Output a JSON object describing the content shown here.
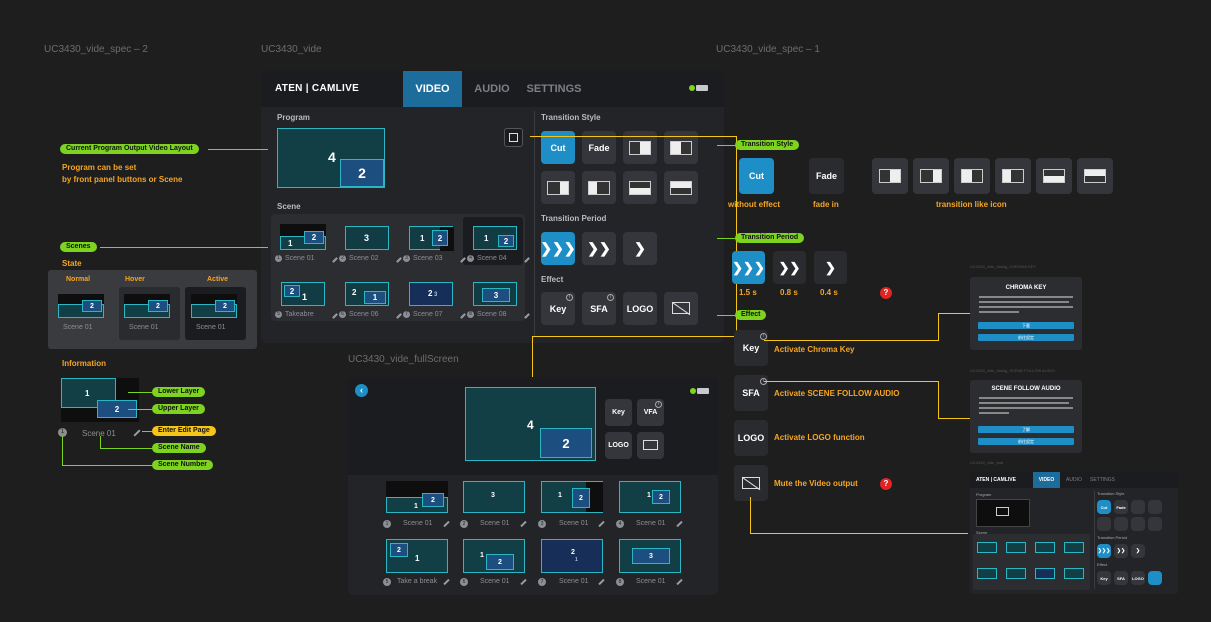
{
  "frames": {
    "spec2": "UC3430_vide_spec – 2",
    "vide": "UC3430_vide",
    "spec1": "UC3430_vide_spec – 1",
    "fullscreen": "UC3430_vide_fullScreen",
    "mini_label": "UC3430_vide_stat"
  },
  "app": {
    "logo": "ATEN | CAMLIVE",
    "tabs": [
      "VIDEO",
      "AUDIO",
      "SETTINGS"
    ],
    "program_label": "Program",
    "program_big": "4",
    "program_small": "2",
    "scene_label": "Scene",
    "transition_style_label": "Transition Style",
    "transition_period_label": "Transition Period",
    "effect_label": "Effect",
    "cut": "Cut",
    "fade": "Fade",
    "effects": [
      "Key",
      "SFA",
      "LOGO"
    ],
    "scenes": [
      {
        "n": "1",
        "name": "Scene 01",
        "big": "1",
        "small": "2"
      },
      {
        "n": "2",
        "name": "Scene 02",
        "big": "3",
        "small": ""
      },
      {
        "n": "3",
        "name": "Scene 03",
        "big": "1",
        "small": "2"
      },
      {
        "n": "4",
        "name": "Scene 04",
        "big": "1",
        "small": "2"
      },
      {
        "n": "5",
        "name": "Takeabre",
        "big": "1",
        "small": "2"
      },
      {
        "n": "6",
        "name": "Scene 06",
        "big": "2",
        "small": "1"
      },
      {
        "n": "7",
        "name": "Scene 07",
        "big": "2",
        "small": "3"
      },
      {
        "n": "8",
        "name": "Scene 08",
        "big": "3",
        "small": ""
      }
    ]
  },
  "spec_left": {
    "program_pill": "Current Program Output Video Layout",
    "program_note_1": "Program can be set",
    "program_note_2": "by front panel buttons or  Scene",
    "scenes_pill": "Scenes",
    "state_label": "State",
    "states": [
      "Normal",
      "Hover",
      "Active"
    ],
    "state_scene_name": "Scene 01",
    "information_label": "Information",
    "lower_layer": "Lower Layer",
    "upper_layer": "Upper Layer",
    "enter_edit": "Enter Edit Page",
    "scene_name": "Scene Name",
    "scene_number": "Scene Number",
    "info_scene": "Scene 01",
    "info_num": "1",
    "info_big": "1",
    "info_small": "2"
  },
  "spec_right": {
    "ts_pill": "Transition Style",
    "cut_caption": "without effect",
    "fade_caption": "fade in",
    "icon_caption": "transition like icon",
    "tp_pill": "Transition Period",
    "periods": [
      "1.5 s",
      "0.8 s",
      "0.4 s"
    ],
    "effect_pill": "Effect",
    "key_text": "Activate Chroma Key",
    "sfa_text": "Activate SCENE FOLLOW AUDIO",
    "logo_text": "Activate LOGO function",
    "mute_text": "Mute the Video output",
    "q": "?"
  },
  "modals": {
    "chroma_title": "CHROMA KEY",
    "chroma_small_label": "UC3430_vide_dialog_CHROMA KEY",
    "chroma_btn1": "下載",
    "chroma_btn2": "前往設定",
    "sfa_title": "SCENE FOLLOW AUDIO",
    "sfa_small_label": "UC3430_vide_dialog_SCENE FOLLOW AUDIO",
    "sfa_btn1": "了解",
    "sfa_btn2": "前往設定"
  },
  "fullscreen": {
    "big": "4",
    "small": "2",
    "effects": [
      "Key",
      "VFA",
      "LOGO"
    ],
    "scenes": [
      {
        "n": "1",
        "name": "Scene 01",
        "big": "1",
        "small": "2"
      },
      {
        "n": "2",
        "name": "Scene 01",
        "big": "3",
        "small": ""
      },
      {
        "n": "3",
        "name": "Scene 01",
        "big": "1",
        "small": "2"
      },
      {
        "n": "4",
        "name": "Scene 01",
        "big": "1",
        "small": "2"
      },
      {
        "n": "5",
        "name": "Take a break",
        "big": "1",
        "small": "2"
      },
      {
        "n": "6",
        "name": "Scene 01",
        "big": "1",
        "small": "2"
      },
      {
        "n": "7",
        "name": "Scene 01",
        "big": "2",
        "small": "1"
      },
      {
        "n": "8",
        "name": "Scene 01",
        "big": "3",
        "small": ""
      }
    ]
  },
  "mini": {
    "logo": "ATEN | CAMLIVE",
    "tabs": [
      "VIDEO",
      "AUDIO",
      "SETTINGS"
    ],
    "program": "Program",
    "scene": "Scene",
    "ts": "Transition Style",
    "tp": "Transition Period",
    "effect": "Effect",
    "cut": "Cut",
    "fade": "Fade",
    "effects": [
      "Key",
      "SFA",
      "LOGO"
    ]
  },
  "colors": {
    "accent": "#1d8fc6",
    "teal": "#2ab7c3",
    "green": "#7ed321",
    "yellow": "#f5c518",
    "orange": "#f5a623",
    "red": "#e02424"
  }
}
